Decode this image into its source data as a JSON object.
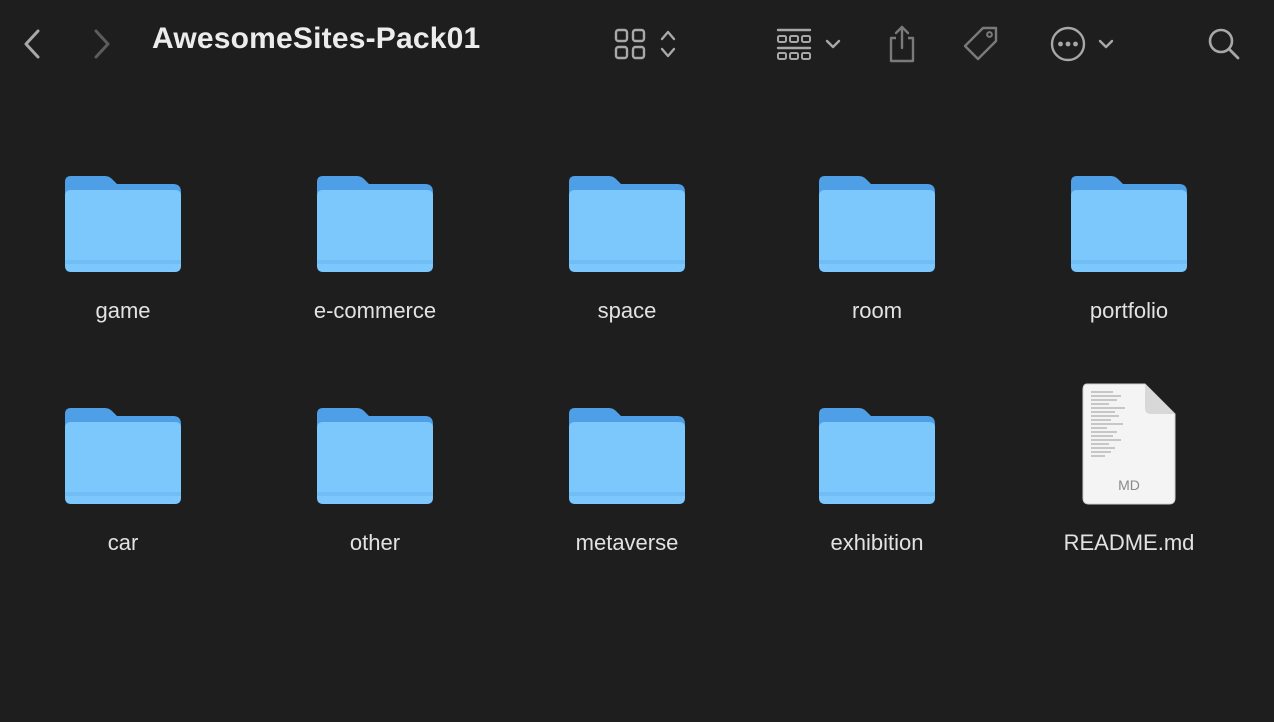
{
  "window": {
    "title": "AwesomeSites-Pack01"
  },
  "toolbar": {
    "back_icon": "chevron-left-icon",
    "forward_icon": "chevron-right-icon",
    "view_icon": "grid-view-icon",
    "view_toggle_icon": "up-down-chevron-icon",
    "group_icon": "group-by-icon",
    "group_dropdown_icon": "chevron-down-icon",
    "share_icon": "share-icon",
    "tag_icon": "tag-icon",
    "more_icon": "ellipsis-circle-icon",
    "more_dropdown_icon": "chevron-down-icon",
    "search_icon": "search-icon"
  },
  "items": [
    {
      "name": "game",
      "kind": "folder"
    },
    {
      "name": "e-commerce",
      "kind": "folder"
    },
    {
      "name": "space",
      "kind": "folder"
    },
    {
      "name": "room",
      "kind": "folder"
    },
    {
      "name": "portfolio",
      "kind": "folder"
    },
    {
      "name": "car",
      "kind": "folder"
    },
    {
      "name": "other",
      "kind": "folder"
    },
    {
      "name": "metaverse",
      "kind": "folder"
    },
    {
      "name": "exhibition",
      "kind": "folder"
    },
    {
      "name": "README.md",
      "kind": "file",
      "badge": "MD"
    }
  ],
  "colors": {
    "background": "#1e1e1e",
    "folder_back": "#4f9fe6",
    "folder_front": "#7cc7fb",
    "icon_gray": "#9a9a9a"
  }
}
